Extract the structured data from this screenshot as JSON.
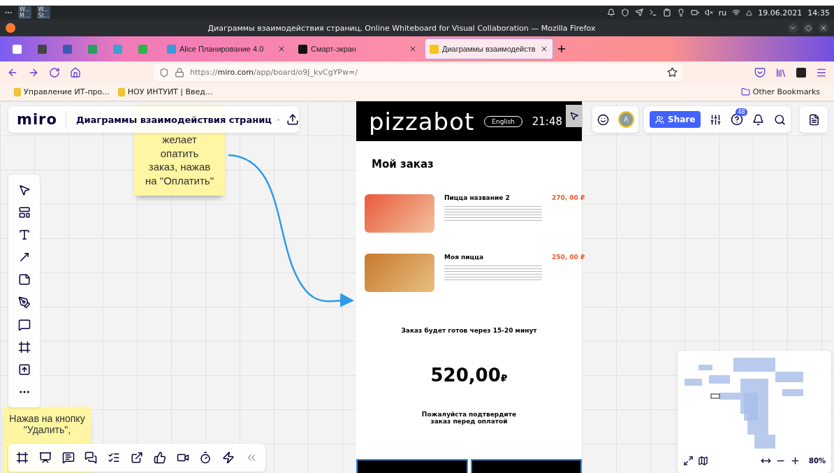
{
  "system_panel": {
    "tasks": [
      {
        "top": "W...",
        "bottom": "M..."
      },
      {
        "top": "W...",
        "bottom": "St..."
      }
    ],
    "keyboard": "ru",
    "date": "19.06.2021",
    "time": "14:35"
  },
  "window": {
    "title": "Диаграммы взаимодействия страниц, Online Whiteboard for Visual Collaboration — Mozilla Firefox"
  },
  "tabs": [
    {
      "label": "Alice Планирование 4.0",
      "selected": false
    },
    {
      "label": "Смарт-экран",
      "selected": false
    },
    {
      "label": "Диаграммы взаимодейств",
      "selected": true
    }
  ],
  "address_bar": {
    "scheme": "https://",
    "host": "miro.com",
    "path": "/app/board/o9J_kvCgYPw=/"
  },
  "bookmarks": [
    {
      "label": "Управление ИТ-про..."
    },
    {
      "label": "НОУ ИНТУИТ | Введ..."
    }
  ],
  "other_bookmarks": "Other Bookmarks",
  "miro": {
    "logo": "miro",
    "board_title": "Диаграммы взаимодействия страниц",
    "avatar": "A",
    "share": "Share",
    "help_badge": "48",
    "zoom": "80%"
  },
  "stickies": [
    {
      "text": "желает опатить заказ, нажав на \"Оплатить\""
    },
    {
      "text": "Нажав на кнопку \"Удалить\","
    }
  ],
  "phone": {
    "brand": "pizzabot",
    "language": "English",
    "clock": "21:48",
    "heading": "Мой заказ",
    "items": [
      {
        "name": "Пицца название 2",
        "price": "270, 00 ₽",
        "kind": "tray"
      },
      {
        "name": "Моя пицца",
        "price": "250, 00 ₽",
        "kind": "focaccia"
      }
    ],
    "ready_note": "Заказ будет готов через 15-20 минут",
    "total": "520,00",
    "currency": "₽",
    "confirm_note": "Пожалуйста подтвердите заказ перед оплатой"
  }
}
